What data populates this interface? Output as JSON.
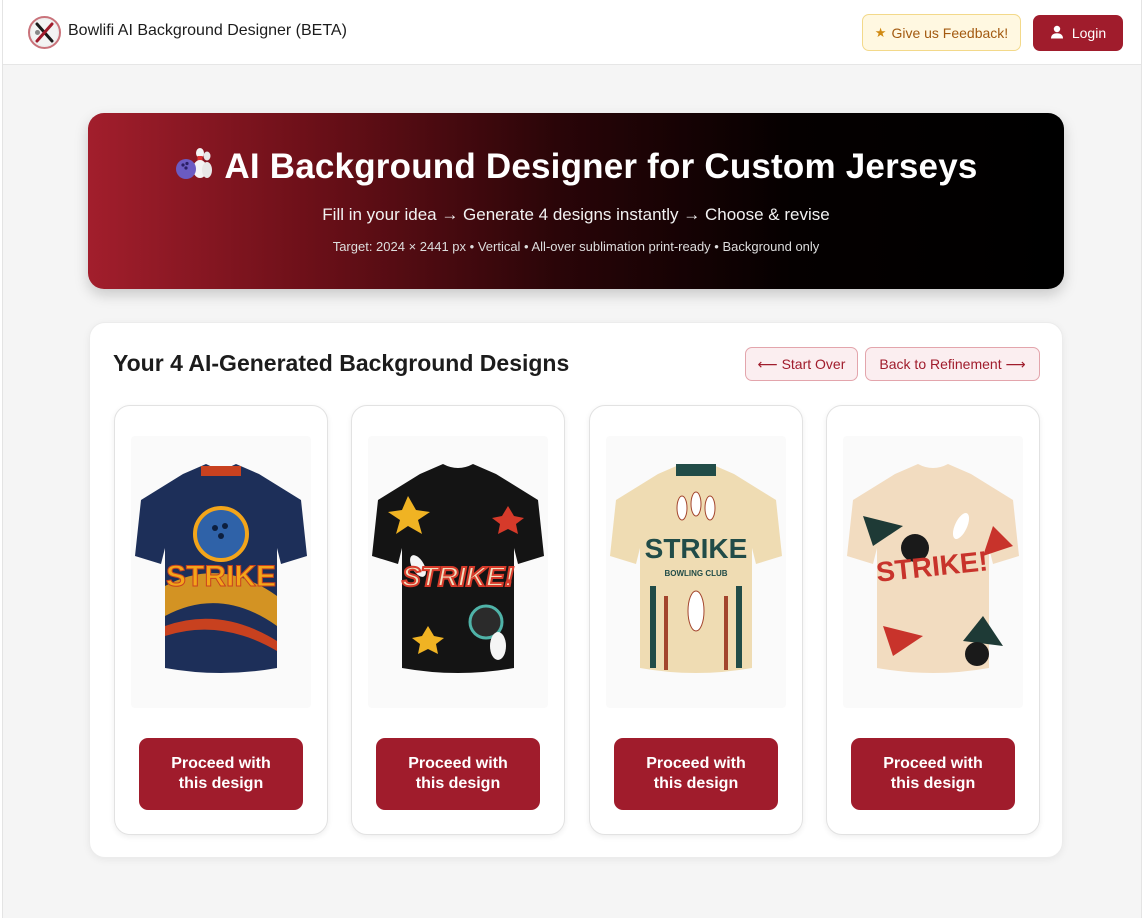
{
  "header": {
    "app_title": "Bowlifi AI Background Designer (BETA)",
    "feedback_label": "Give us Feedback!",
    "login_label": "Login"
  },
  "hero": {
    "title": "AI Background Designer for Custom Jerseys",
    "subtitle": "Fill in your idea → Generate 4 designs instantly → Choose & revise",
    "meta": "Target: 2024 × 2441 px • Vertical • All-over sublimation print-ready • Background only"
  },
  "results": {
    "title": "Your 4 AI-Generated Background Designs",
    "start_over_label": "⟵ Start Over",
    "back_label": "Back to Refinement ⟶",
    "designs": [
      {
        "proceed_label": "Proceed with this design",
        "jersey_text": "STRIKE",
        "colors": {
          "base": "#1d2f59",
          "accent": "#f3a51a",
          "trim": "#c8411f"
        }
      },
      {
        "proceed_label": "Proceed with this design",
        "jersey_text": "STRIKE!",
        "colors": {
          "base": "#141414",
          "accent": "#f0b323",
          "trim": "#d63a2a"
        }
      },
      {
        "proceed_label": "Proceed with this design",
        "jersey_text": "STRIKE",
        "jersey_subtext": "BOWLING CLUB",
        "colors": {
          "base": "#efdcb3",
          "accent": "#214c48",
          "trim": "#a3452d"
        }
      },
      {
        "proceed_label": "Proceed with this design",
        "jersey_text": "STRIKE!",
        "colors": {
          "base": "#f2dcc0",
          "accent": "#c8332b",
          "trim": "#1e3a36"
        }
      }
    ]
  },
  "colors": {
    "brand": "#a01c2c",
    "hero_start": "#a21e2c",
    "hero_end": "#000000"
  },
  "icons": {
    "logo": "bowling-logo-icon",
    "feedback": "star-icon",
    "login": "user-icon",
    "hero": "bowling-pins-icon"
  }
}
